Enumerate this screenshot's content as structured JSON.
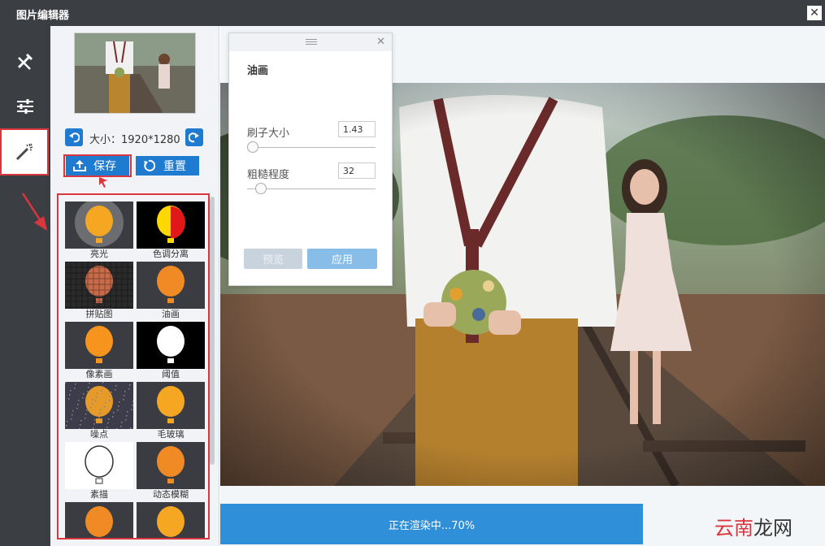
{
  "window": {
    "title": "图片编辑器",
    "close_glyph": "✕"
  },
  "rail": {
    "items": [
      {
        "name": "tools",
        "icon": "tools-icon"
      },
      {
        "name": "adjust",
        "icon": "sliders-icon"
      },
      {
        "name": "effects",
        "icon": "magic-wand-icon",
        "active": true
      }
    ]
  },
  "panel": {
    "size_label": "大小：1920*1280",
    "save_label": "保存",
    "reset_label": "重置",
    "filters": [
      {
        "label": "亮光"
      },
      {
        "label": "色调分离"
      },
      {
        "label": "拼贴图"
      },
      {
        "label": "油画"
      },
      {
        "label": "像素画"
      },
      {
        "label": "阈值"
      },
      {
        "label": "噪点"
      },
      {
        "label": "毛玻璃"
      },
      {
        "label": "素描"
      },
      {
        "label": "动态模糊"
      },
      {
        "label": ""
      },
      {
        "label": ""
      }
    ]
  },
  "dialog": {
    "title": "油画",
    "brush_label": "刷子大小",
    "brush_value": "1.43",
    "rough_label": "粗糙程度",
    "rough_value": "32",
    "preview_label": "预览",
    "apply_label": "应用"
  },
  "status": {
    "progress_text": "正在渲染中...70%",
    "progress": 0.7
  },
  "watermark": {
    "part1": "云南",
    "part2": "龙网"
  },
  "colors": {
    "accent": "#1f7bd0",
    "highlight": "#d9363e",
    "dark": "#3b3e43"
  }
}
